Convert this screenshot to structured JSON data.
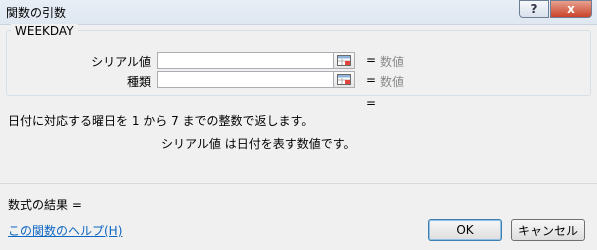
{
  "dialog": {
    "title": "関数の引数",
    "help_button": "?",
    "close_button": "x"
  },
  "function": {
    "name": "WEEKDAY",
    "arguments": [
      {
        "label": "シリアル値",
        "equals": "=",
        "value_hint": "数値"
      },
      {
        "label": "種類",
        "equals": "=",
        "value_hint": "数値"
      }
    ],
    "result_equals": "=",
    "description": "日付に対応する曜日を 1 から 7 までの整数で返します。",
    "argument_description": "シリアル値 は日付を表す数値です。"
  },
  "footer": {
    "formula_result": "数式の結果 =",
    "help_link": "この関数のヘルプ(H)",
    "ok_label": "OK",
    "cancel_label": "キャンセル"
  }
}
